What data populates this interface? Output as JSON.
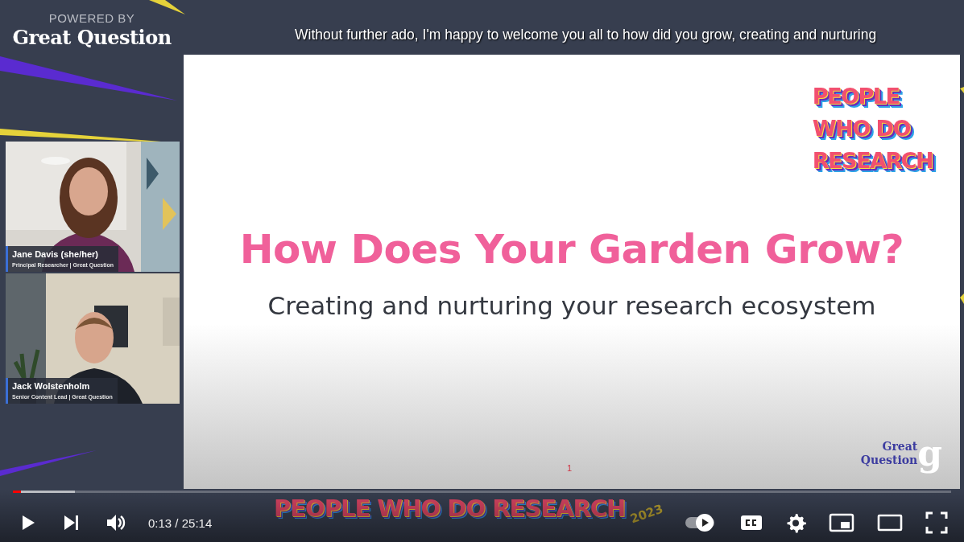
{
  "caption": "Without further ado, I'm happy to welcome you all to how did you grow, creating and nurturing",
  "video": {
    "branding": {
      "overline": "POWERED BY",
      "name": "Great Question"
    },
    "participants": [
      {
        "name": "Jane Davis (she/her)",
        "role": "Principal Researcher | Great Question"
      },
      {
        "name": "Jack Wolstenholm",
        "role": "Senior Content Lead | Great Question"
      }
    ],
    "slide": {
      "logo_lines": [
        "PEOPLE",
        "WHO DO",
        "RESEARCH"
      ],
      "title": "How Does Your Garden Grow?",
      "subtitle": "Creating and nurturing your research ecosystem",
      "page_number": "1",
      "footer_logo": {
        "lines": [
          "Great",
          "Question"
        ],
        "mark": "g"
      }
    },
    "banner": {
      "text": "PEOPLE WHO DO RESEARCH",
      "year": "2023"
    }
  },
  "player": {
    "progress": {
      "played": {
        "level": 0.009
      },
      "buffered": {
        "level": 0.066
      }
    },
    "left_controls": [
      {
        "kind": "play"
      },
      {
        "kind": "next"
      },
      {
        "kind": "volume"
      }
    ],
    "time": "0:13 / 25:14",
    "right_controls": [
      {
        "kind": "autoplay"
      },
      {
        "kind": "captions"
      },
      {
        "kind": "settings"
      },
      {
        "kind": "miniplayer"
      },
      {
        "kind": "theater"
      },
      {
        "kind": "fullscreen"
      }
    ]
  }
}
